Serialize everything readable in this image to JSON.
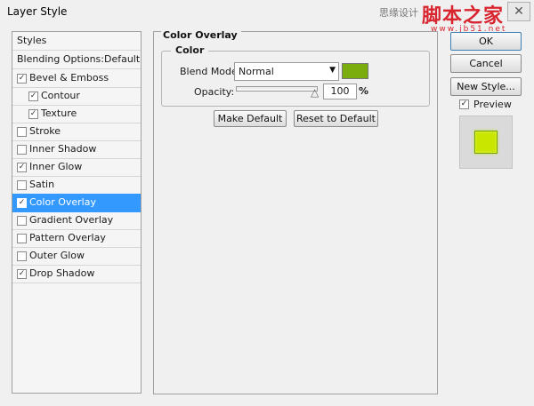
{
  "window": {
    "title": "Layer Style",
    "close_glyph": "✕"
  },
  "watermark": {
    "cn_text": "思缘设计",
    "logo_text": "脚本之家",
    "url": "www.jb51.net"
  },
  "left_panel": {
    "items": [
      {
        "label": "Styles",
        "checkbox": false
      },
      {
        "label": "Blending Options:Default",
        "checkbox": false
      },
      {
        "label": "Bevel & Emboss",
        "checkbox": true,
        "checked": true
      },
      {
        "label": "Contour",
        "checkbox": true,
        "checked": true
      },
      {
        "label": "Texture",
        "checkbox": true,
        "checked": true
      },
      {
        "label": "Stroke",
        "checkbox": true,
        "checked": false
      },
      {
        "label": "Inner Shadow",
        "checkbox": true,
        "checked": false
      },
      {
        "label": "Inner Glow",
        "checkbox": true,
        "checked": true
      },
      {
        "label": "Satin",
        "checkbox": true,
        "checked": false
      },
      {
        "label": "Color Overlay",
        "checkbox": true,
        "checked": true,
        "selected": true
      },
      {
        "label": "Gradient Overlay",
        "checkbox": true,
        "checked": false
      },
      {
        "label": "Pattern Overlay",
        "checkbox": true,
        "checked": false
      },
      {
        "label": "Outer Glow",
        "checkbox": true,
        "checked": false
      },
      {
        "label": "Drop Shadow",
        "checkbox": true,
        "checked": true
      }
    ]
  },
  "color_overlay": {
    "section_title": "Color Overlay",
    "group_title": "Color",
    "blend_mode_label": "Blend Mode:",
    "blend_mode_value": "Normal",
    "overlay_color": "#7bad0f",
    "opacity_label": "Opacity:",
    "opacity_value": "100",
    "opacity_unit": "%",
    "make_default_label": "Make Default",
    "reset_default_label": "Reset to Default"
  },
  "actions": {
    "ok_label": "OK",
    "cancel_label": "Cancel",
    "new_style_label": "New Style...",
    "preview_label": "Preview",
    "preview_checked": true
  },
  "colors": {
    "selection": "#3399ff",
    "preview_fill": "#c8e600"
  }
}
